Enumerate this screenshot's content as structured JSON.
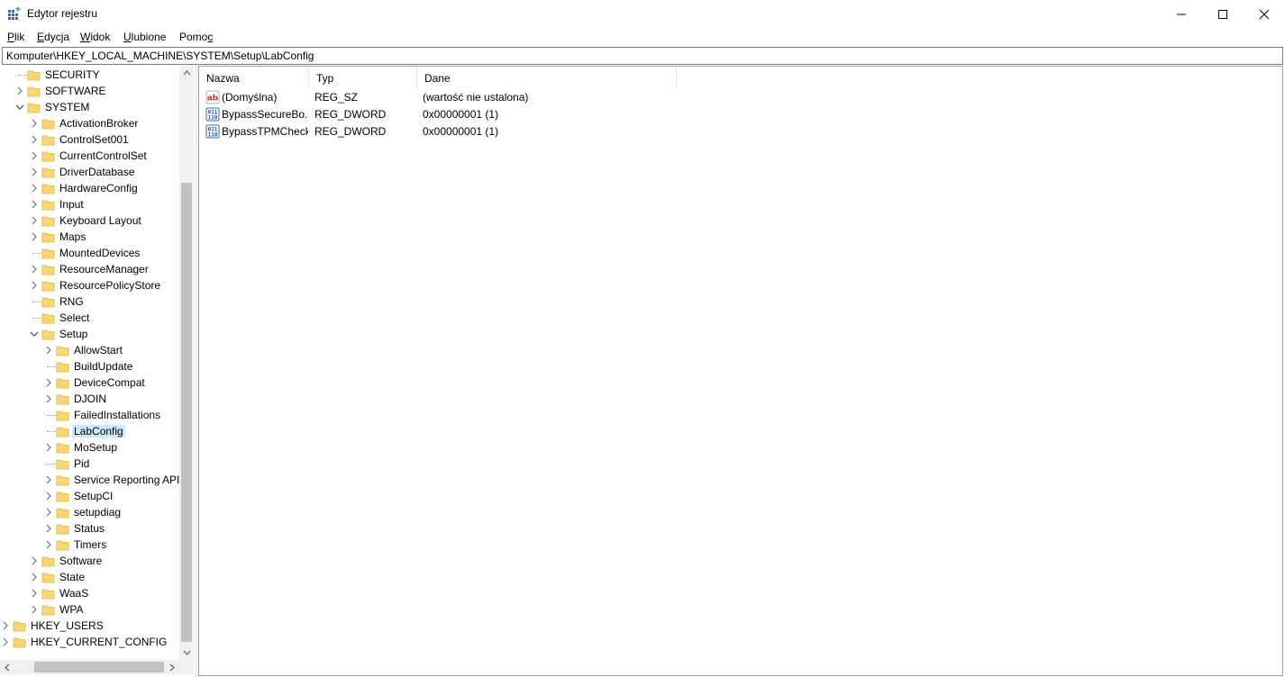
{
  "window": {
    "title": "Edytor rejestru"
  },
  "menu": [
    {
      "acc": "P",
      "rest": "lik"
    },
    {
      "acc": "E",
      "rest": "dycja"
    },
    {
      "acc": "W",
      "rest": "idok"
    },
    {
      "acc": "U",
      "rest": "lubione"
    },
    {
      "pre": "Pomo",
      "acc": "c",
      "rest": ""
    }
  ],
  "address": "Komputer\\HKEY_LOCAL_MACHINE\\SYSTEM\\Setup\\LabConfig",
  "tree": [
    {
      "label": "SECURITY",
      "depth": 1,
      "expander": "none"
    },
    {
      "label": "SOFTWARE",
      "depth": 1,
      "expander": "collapsed"
    },
    {
      "label": "SYSTEM",
      "depth": 1,
      "expander": "expanded"
    },
    {
      "label": "ActivationBroker",
      "depth": 2,
      "expander": "collapsed"
    },
    {
      "label": "ControlSet001",
      "depth": 2,
      "expander": "collapsed"
    },
    {
      "label": "CurrentControlSet",
      "depth": 2,
      "expander": "collapsed"
    },
    {
      "label": "DriverDatabase",
      "depth": 2,
      "expander": "collapsed"
    },
    {
      "label": "HardwareConfig",
      "depth": 2,
      "expander": "collapsed"
    },
    {
      "label": "Input",
      "depth": 2,
      "expander": "collapsed"
    },
    {
      "label": "Keyboard Layout",
      "depth": 2,
      "expander": "collapsed"
    },
    {
      "label": "Maps",
      "depth": 2,
      "expander": "collapsed"
    },
    {
      "label": "MountedDevices",
      "depth": 2,
      "expander": "none"
    },
    {
      "label": "ResourceManager",
      "depth": 2,
      "expander": "collapsed"
    },
    {
      "label": "ResourcePolicyStore",
      "depth": 2,
      "expander": "collapsed"
    },
    {
      "label": "RNG",
      "depth": 2,
      "expander": "none"
    },
    {
      "label": "Select",
      "depth": 2,
      "expander": "none"
    },
    {
      "label": "Setup",
      "depth": 2,
      "expander": "expanded"
    },
    {
      "label": "AllowStart",
      "depth": 3,
      "expander": "collapsed"
    },
    {
      "label": "BuildUpdate",
      "depth": 3,
      "expander": "none"
    },
    {
      "label": "DeviceCompat",
      "depth": 3,
      "expander": "collapsed"
    },
    {
      "label": "DJOIN",
      "depth": 3,
      "expander": "collapsed"
    },
    {
      "label": "FailedInstallations",
      "depth": 3,
      "expander": "none"
    },
    {
      "label": "LabConfig",
      "depth": 3,
      "expander": "none",
      "selected": true
    },
    {
      "label": "MoSetup",
      "depth": 3,
      "expander": "collapsed"
    },
    {
      "label": "Pid",
      "depth": 3,
      "expander": "none"
    },
    {
      "label": "Service Reporting API",
      "depth": 3,
      "expander": "collapsed"
    },
    {
      "label": "SetupCI",
      "depth": 3,
      "expander": "collapsed"
    },
    {
      "label": "setupdiag",
      "depth": 3,
      "expander": "collapsed"
    },
    {
      "label": "Status",
      "depth": 3,
      "expander": "collapsed"
    },
    {
      "label": "Timers",
      "depth": 3,
      "expander": "collapsed"
    },
    {
      "label": "Software",
      "depth": 2,
      "expander": "collapsed"
    },
    {
      "label": "State",
      "depth": 2,
      "expander": "collapsed"
    },
    {
      "label": "WaaS",
      "depth": 2,
      "expander": "collapsed"
    },
    {
      "label": "WPA",
      "depth": 2,
      "expander": "collapsed"
    },
    {
      "label": "HKEY_USERS",
      "depth": 0,
      "expander": "collapsed"
    },
    {
      "label": "HKEY_CURRENT_CONFIG",
      "depth": 0,
      "expander": "collapsed"
    }
  ],
  "columns": {
    "name": "Nazwa",
    "type": "Typ",
    "data": "Dane"
  },
  "values": [
    {
      "icon": "string-value-icon",
      "name": "(Domyślna)",
      "type": "REG_SZ",
      "data": "(wartość nie ustalona)"
    },
    {
      "icon": "binary-value-icon",
      "name": "BypassSecureBo...",
      "type": "REG_DWORD",
      "data": "0x00000001 (1)"
    },
    {
      "icon": "binary-value-icon",
      "name": "BypassTPMCheck",
      "type": "REG_DWORD",
      "data": "0x00000001 (1)"
    }
  ],
  "colors": {
    "selection": "#cce8ff",
    "folder": "#f8d775",
    "folder_dark": "#e0b23c"
  }
}
